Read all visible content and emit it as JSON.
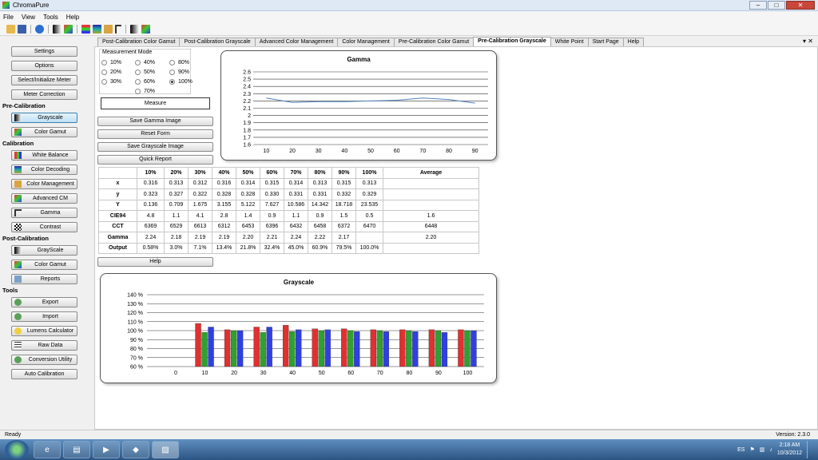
{
  "window": {
    "title": "ChromaPure"
  },
  "menu": [
    "File",
    "View",
    "Tools",
    "Help"
  ],
  "sidebar": {
    "settings": "Settings",
    "options": "Options",
    "select_meter": "Select/Initialize Meter",
    "meter_correction": "Meter Correction",
    "pre_calibration": "Pre-Calibration",
    "grayscale": "Grayscale",
    "color_gamut": "Color Gamut",
    "calibration": "Calibration",
    "white_balance": "White Balance",
    "color_decoding": "Color Decoding",
    "color_management": "Color Management",
    "advanced_cm": "Advanced CM",
    "gamma": "Gamma",
    "contrast": "Contrast",
    "post_calibration": "Post-Calibration",
    "post_grayscale": "GrayScale",
    "post_color_gamut": "Color Gamut",
    "reports": "Reports",
    "tools": "Tools",
    "export": "Export",
    "import": "Import",
    "lumens": "Lumens Calculator",
    "raw_data": "Raw Data",
    "conversion": "Conversion Utility",
    "auto_cal": "Auto Calibration"
  },
  "tabs": [
    "Post-Calibration Color Gamut",
    "Post-Calibration Grayscale",
    "Advanced Color Management",
    "Color Management",
    "Pre-Calibration Color Gamut",
    "Pre-Calibration Grayscale",
    "White Point",
    "Start Page",
    "Help"
  ],
  "measurement_mode": {
    "label": "Measurement Mode",
    "options": [
      "10%",
      "40%",
      "80%",
      "20%",
      "50%",
      "90%",
      "30%",
      "60%",
      "100%",
      "70%"
    ],
    "selected": "100%"
  },
  "buttons": {
    "measure": "Measure",
    "save_gamma": "Save Gamma Image",
    "reset": "Reset Form",
    "save_grayscale": "Save Grayscale Image",
    "quick_report": "Quick Report",
    "help": "Help"
  },
  "table": {
    "headers": [
      "",
      "10%",
      "20%",
      "30%",
      "40%",
      "50%",
      "60%",
      "70%",
      "80%",
      "90%",
      "100%",
      "Average"
    ],
    "rows": [
      [
        "x",
        "0.316",
        "0.313",
        "0.312",
        "0.316",
        "0.314",
        "0.315",
        "0.314",
        "0.313",
        "0.315",
        "0.313",
        ""
      ],
      [
        "y",
        "0.323",
        "0.327",
        "0.322",
        "0.328",
        "0.328",
        "0.330",
        "0.331",
        "0.331",
        "0.332",
        "0.329",
        ""
      ],
      [
        "Y",
        "0.136",
        "0.709",
        "1.675",
        "3.155",
        "5.122",
        "7.627",
        "10.586",
        "14.342",
        "18.718",
        "23.535",
        ""
      ],
      [
        "CIE94",
        "4.8",
        "1.1",
        "4.1",
        "2.8",
        "1.4",
        "0.9",
        "1.1",
        "0.9",
        "1.5",
        "0.5",
        "1.6"
      ],
      [
        "CCT",
        "6369",
        "6529",
        "6613",
        "6312",
        "6453",
        "6396",
        "6432",
        "6458",
        "6372",
        "6470",
        "6448"
      ],
      [
        "Gamma",
        "2.24",
        "2.18",
        "2.19",
        "2.19",
        "2.20",
        "2.21",
        "2.24",
        "2.22",
        "2.17",
        "",
        "2.20"
      ],
      [
        "Output",
        "0.58%",
        "3.0%",
        "7.1%",
        "13.4%",
        "21.8%",
        "32.4%",
        "45.0%",
        "60.9%",
        "79.5%",
        "100.0%",
        ""
      ]
    ]
  },
  "chart_data": [
    {
      "type": "line",
      "title": "Gamma",
      "x": [
        10,
        20,
        30,
        40,
        50,
        60,
        70,
        80,
        90
      ],
      "values": [
        2.24,
        2.18,
        2.19,
        2.19,
        2.2,
        2.21,
        2.24,
        2.22,
        2.17
      ],
      "ylim": [
        1.6,
        2.6
      ],
      "yticks": [
        "2.6",
        "2.5",
        "2.4",
        "2.3",
        "2.2",
        "2.1",
        "2",
        "1.9",
        "1.8",
        "1.7",
        "1.6"
      ],
      "xticks": [
        "10",
        "20",
        "30",
        "40",
        "50",
        "60",
        "70",
        "80",
        "90"
      ],
      "color": "#4f81bd",
      "grid": true
    },
    {
      "type": "bar",
      "title": "Grayscale",
      "categories": [
        "0",
        "10",
        "20",
        "30",
        "40",
        "50",
        "60",
        "70",
        "80",
        "90",
        "100"
      ],
      "series": [
        {
          "values": [
            null,
            108,
            101,
            104,
            106,
            102,
            102,
            101,
            101,
            101,
            101
          ],
          "color": "#e03030"
        },
        {
          "values": [
            null,
            98,
            100,
            98,
            99,
            100,
            100,
            100,
            100,
            100,
            100
          ],
          "color": "#30a030"
        },
        {
          "values": [
            null,
            104,
            100,
            104,
            101,
            101,
            99,
            99,
            99,
            98,
            100
          ],
          "color": "#3040e0"
        }
      ],
      "ylim": [
        60,
        140
      ],
      "yticks": [
        "140 %",
        "130 %",
        "120 %",
        "110 %",
        "100 %",
        "90 %",
        "80 %",
        "70 %",
        "60 %"
      ],
      "grid": true
    }
  ],
  "status": {
    "text": "Ready",
    "version": "Version: 2.3.0"
  },
  "taskbar": {
    "lang": "ES",
    "time": "2:18 AM",
    "date": "10/3/2012"
  }
}
